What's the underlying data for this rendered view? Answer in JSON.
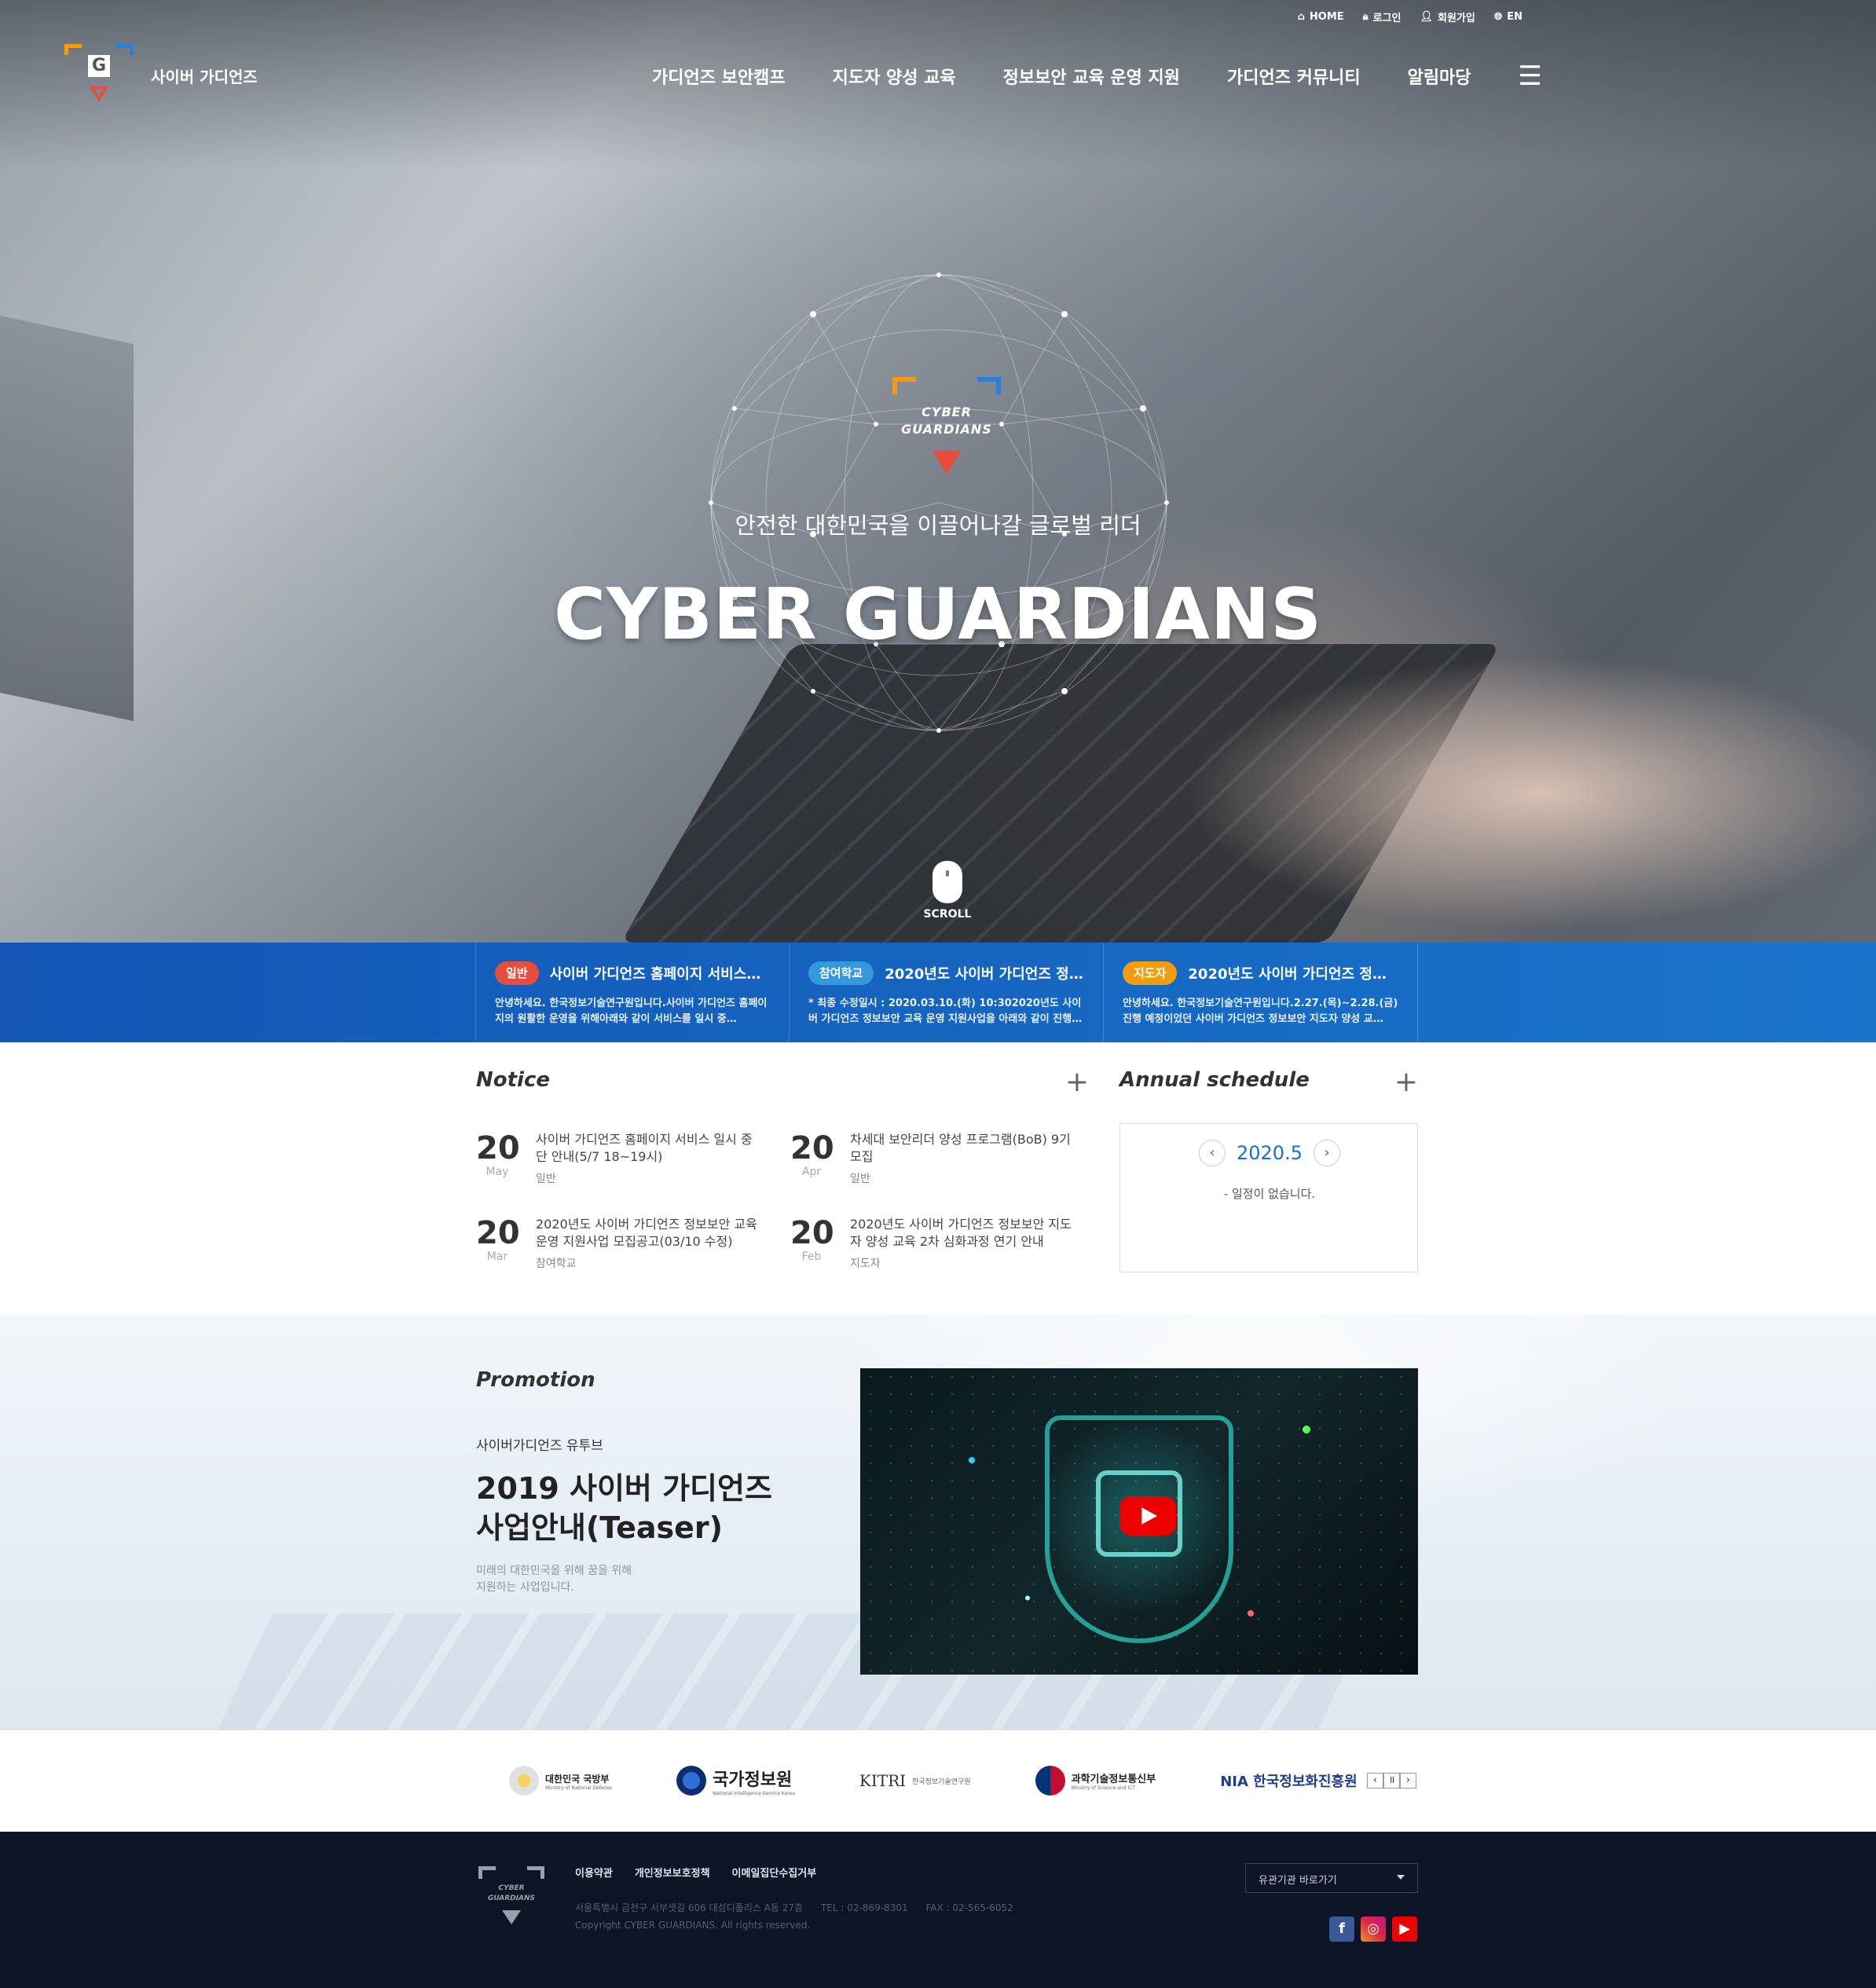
{
  "utility_nav": {
    "home": "HOME",
    "login": "로그인",
    "signup": "회원가입",
    "lang": "EN"
  },
  "brand": {
    "name": "사이버 가디언즈"
  },
  "gnb": [
    "가디언즈 보안캠프",
    "지도자 양성 교육",
    "정보보안 교육 운영 지원",
    "가디언즈 커뮤니티",
    "알림마당"
  ],
  "hero": {
    "logo_text": [
      "CYBER",
      "GUARDIANS"
    ],
    "tagline": "안전한 대한민국을 이끌어나갈 글로벌 리더",
    "title": "CYBER GUARDIANS",
    "scroll": "SCROLL"
  },
  "strip": [
    {
      "badge": "일반",
      "badge_color": "#e74c3c",
      "title": "사이버 가디언즈 홈페이지 서비스 …",
      "desc": "안녕하세요. 한국정보기술연구원입니다.사이버 가디언즈 홈페이지의 원활한 운영을 위해아래와 같이 서비스를 일시 중…"
    },
    {
      "badge": "참여학교",
      "badge_color": "#3498db",
      "title": "2020년도 사이버 가디언즈 정…",
      "desc": "* 최종 수정일시 : 2020.03.10.(화) 10:302020년도 사이버 가디언즈 정보보안 교육 운영 지원사업을 아래와 같이 진행…"
    },
    {
      "badge": "지도자",
      "badge_color": "#f39c12",
      "title": "2020년도 사이버 가디언즈 정보…",
      "desc": "안녕하세요. 한국정보기술연구원입니다.2.27.(목)~2.28.(금) 진행 예정이었던 사이버 가디언즈 정보보안 지도자 양성 교…"
    }
  ],
  "notice": {
    "title": "Notice",
    "items": [
      {
        "day": "20",
        "month": "May",
        "title": "사이버 가디언즈 홈페이지 서비스 일시 중단 안내(5/7 18~19시)",
        "category": "일반"
      },
      {
        "day": "20",
        "month": "Apr",
        "title": "차세대 보안리더 양성 프로그램(BoB) 9기 모집",
        "category": "일반"
      },
      {
        "day": "20",
        "month": "Mar",
        "title": "2020년도 사이버 가디언즈 정보보안 교육 운영 지원사업 모집공고(03/10 수정)",
        "category": "참여학교"
      },
      {
        "day": "20",
        "month": "Feb",
        "title": "2020년도 사이버 가디언즈 정보보안 지도자 양성 교육 2차 심화과정 연기 안내",
        "category": "지도자"
      }
    ]
  },
  "schedule": {
    "title": "Annual schedule",
    "month": "2020.5",
    "empty": "- 일정이 없습니다."
  },
  "promotion": {
    "title": "Promotion",
    "sub": "사이버가디언즈 유투브",
    "headline_1": "2019 사이버 가디언즈",
    "headline_2": "사업안내(Teaser)",
    "desc_1": "미래의 대한민국을 위해 꿈을 위해",
    "desc_2": "지원하는 사업입니다."
  },
  "partners": [
    {
      "name": "대한민국 국방부",
      "sub": "Ministry of National Defense"
    },
    {
      "name": "국가정보원",
      "sub": "National Intelligence Service Korea"
    },
    {
      "name": "KITRI",
      "sub": "한국정보기술연구원"
    },
    {
      "name": "과학기술정보통신부",
      "sub": "Ministry of Science and ICT"
    },
    {
      "name": "NIA 한국정보화진흥원",
      "sub": ""
    }
  ],
  "footer": {
    "logo_text": [
      "CYBER",
      "GUARDIANS"
    ],
    "links": [
      "이용약관",
      "개인정보보호정책",
      "이메일집단수집거부"
    ],
    "address": "서울특별시 금천구 서부샛길 606 대성디폴리스 A동 27층      TEL : 02-869-8301      FAX : 02-565-6052",
    "copyright": "Copyright CYBER GUARDIANS. All rights reserved.",
    "select_label": "유관기관 바로가기"
  }
}
